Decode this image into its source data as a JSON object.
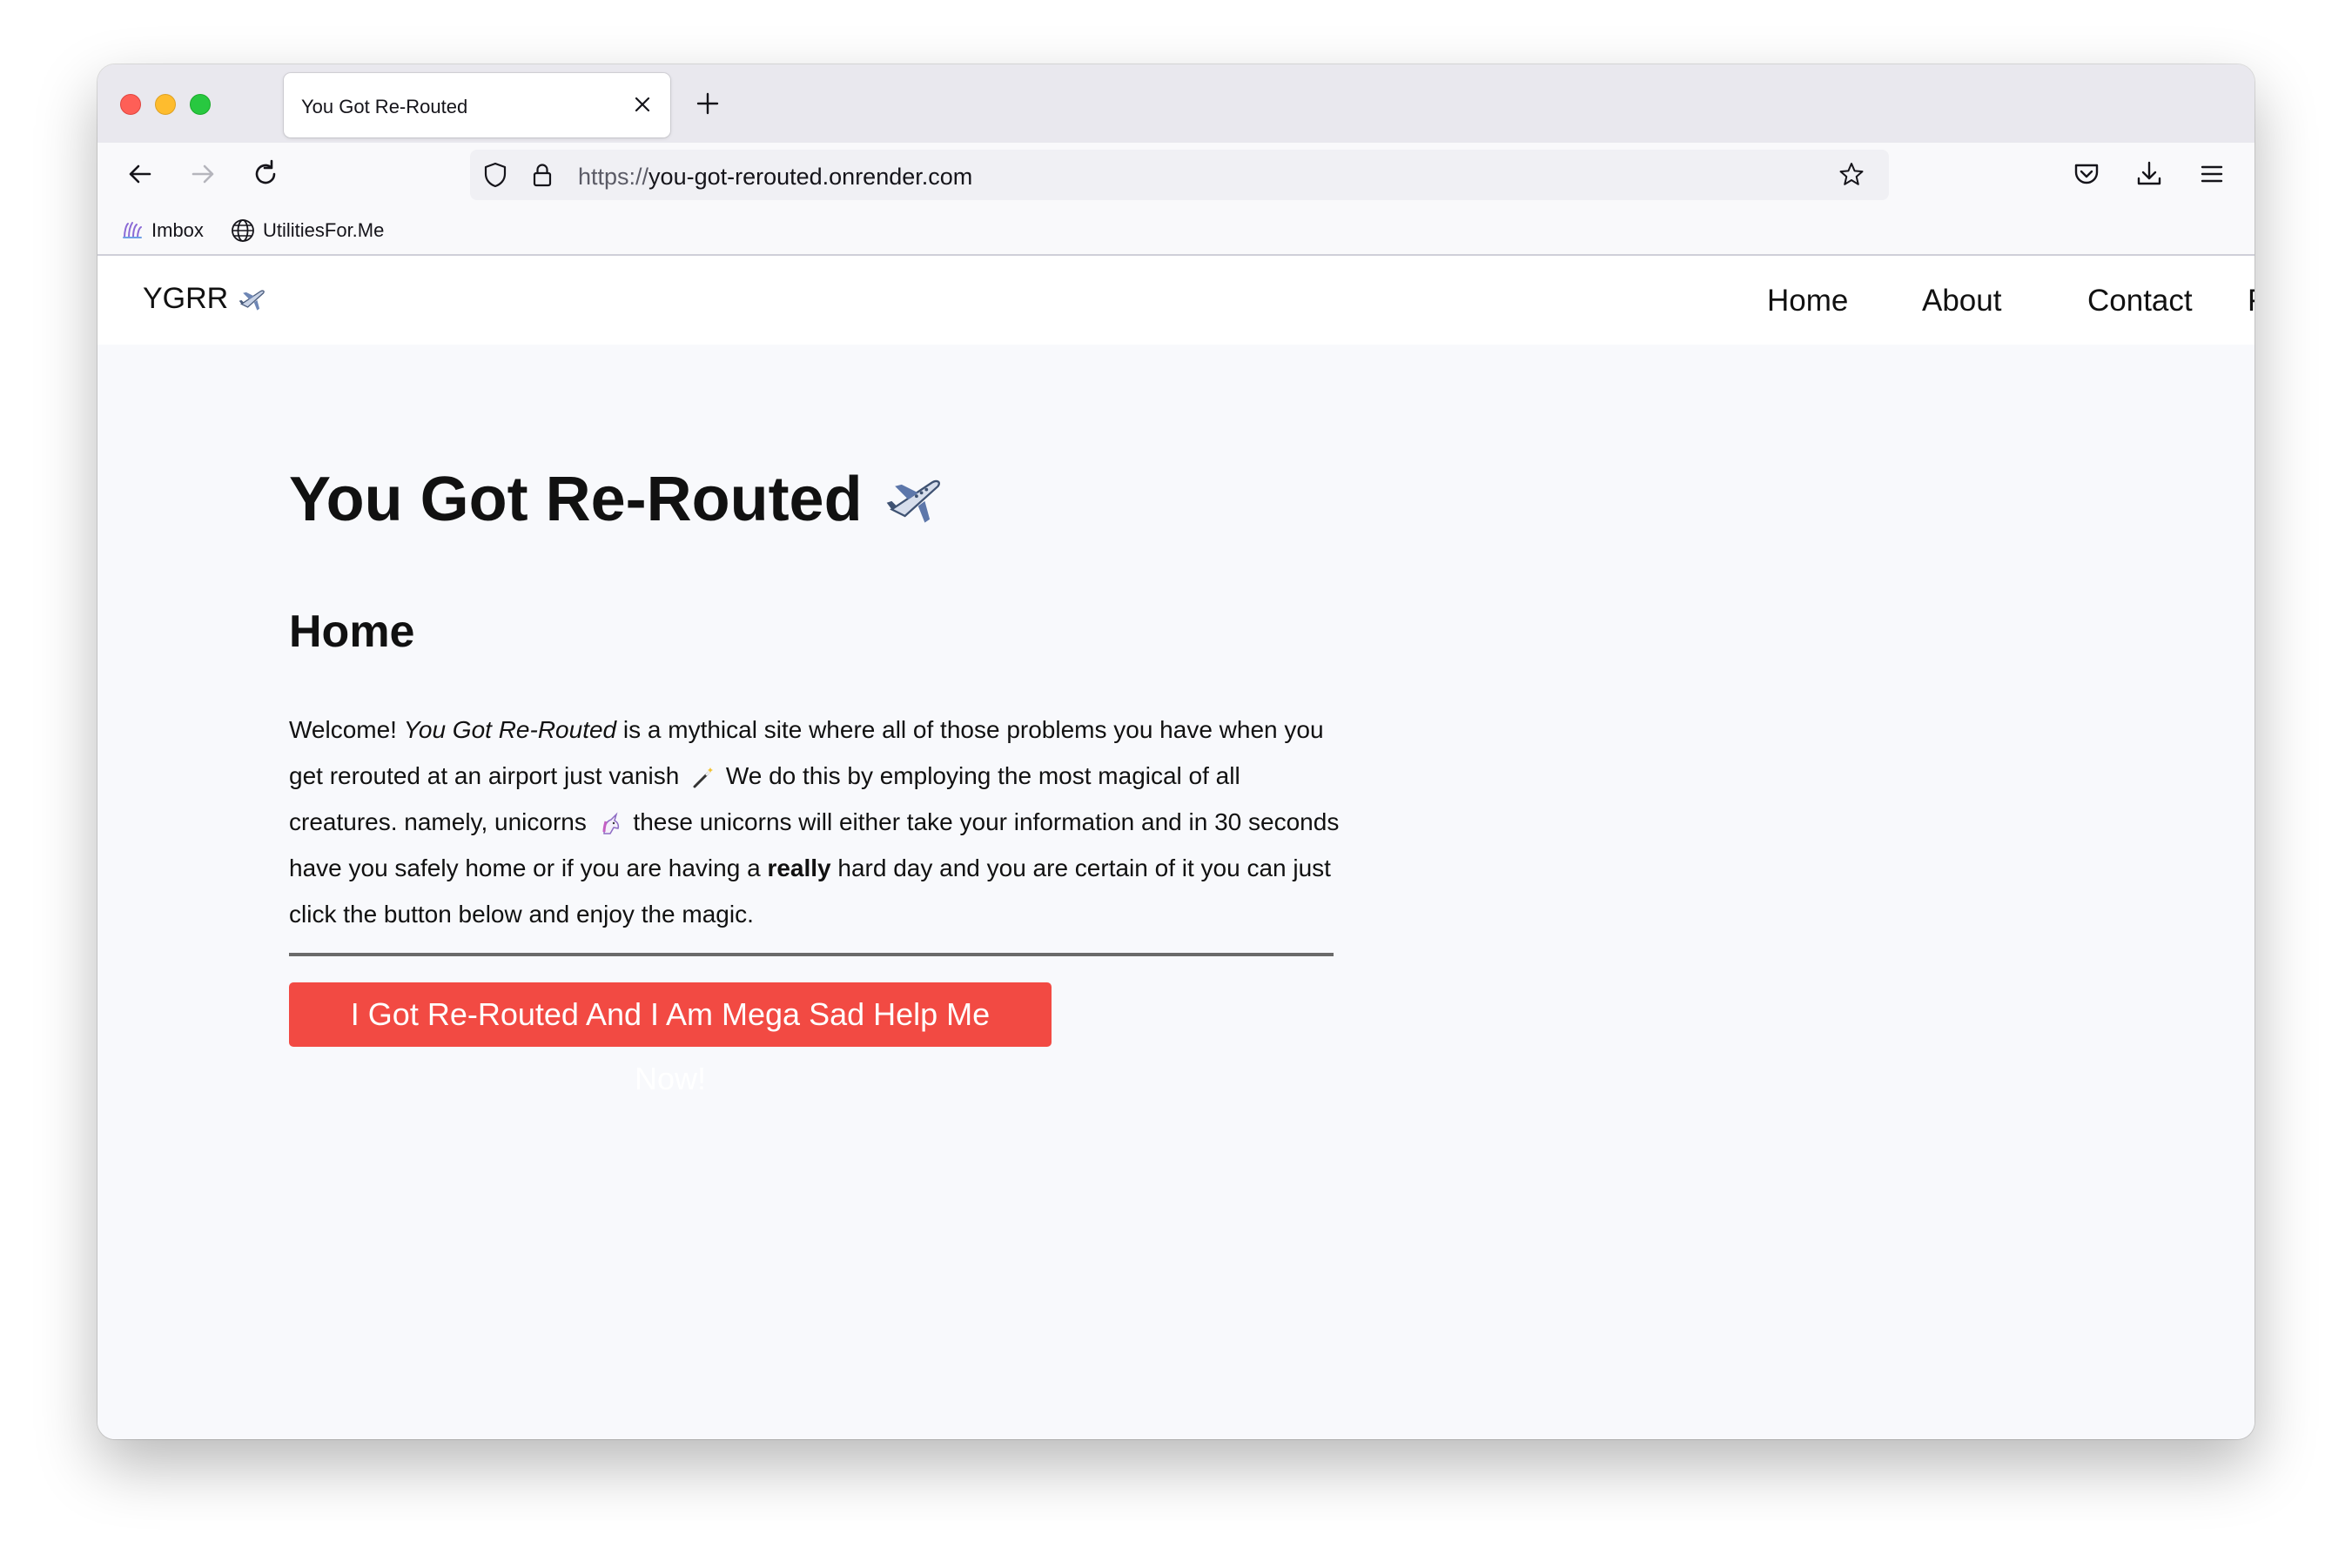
{
  "browser": {
    "tab": {
      "title": "You Got Re-Routed"
    },
    "url": {
      "scheme": "https://",
      "host": "you-got-rerouted.onrender.com"
    },
    "bookmarks": [
      {
        "label": "Imbox",
        "icon": "imbox-icon"
      },
      {
        "label": "UtilitiesFor.Me",
        "icon": "globe-icon"
      }
    ]
  },
  "site": {
    "brand": "YGRR",
    "brand_icon": "airplane-icon",
    "nav": [
      {
        "label": "Home"
      },
      {
        "label": "About"
      },
      {
        "label": "Contact"
      },
      {
        "label": "FAQ"
      }
    ],
    "title": "You Got Re-Routed",
    "section": "Home",
    "paragraph": {
      "p1": "Welcome! ",
      "italic": "You Got Re-Routed",
      "p2": " is a mythical site where all of those problems you have when you get rerouted at an airport just vanish ",
      "p3": " We do this by employing the most magical of all creatures. namely, unicorns ",
      "p4": " these unicorns will either take your information and in 30 seconds have you safely home or if you are having a ",
      "bold": "really",
      "p5": " hard day and you are certain of it you can just click the button below and enjoy the magic."
    },
    "cta": "I Got Re-Routed And I Am Mega Sad Help Me Now!",
    "colors": {
      "cta_bg": "#f24a43",
      "page_bg": "#f8f9fc"
    }
  }
}
